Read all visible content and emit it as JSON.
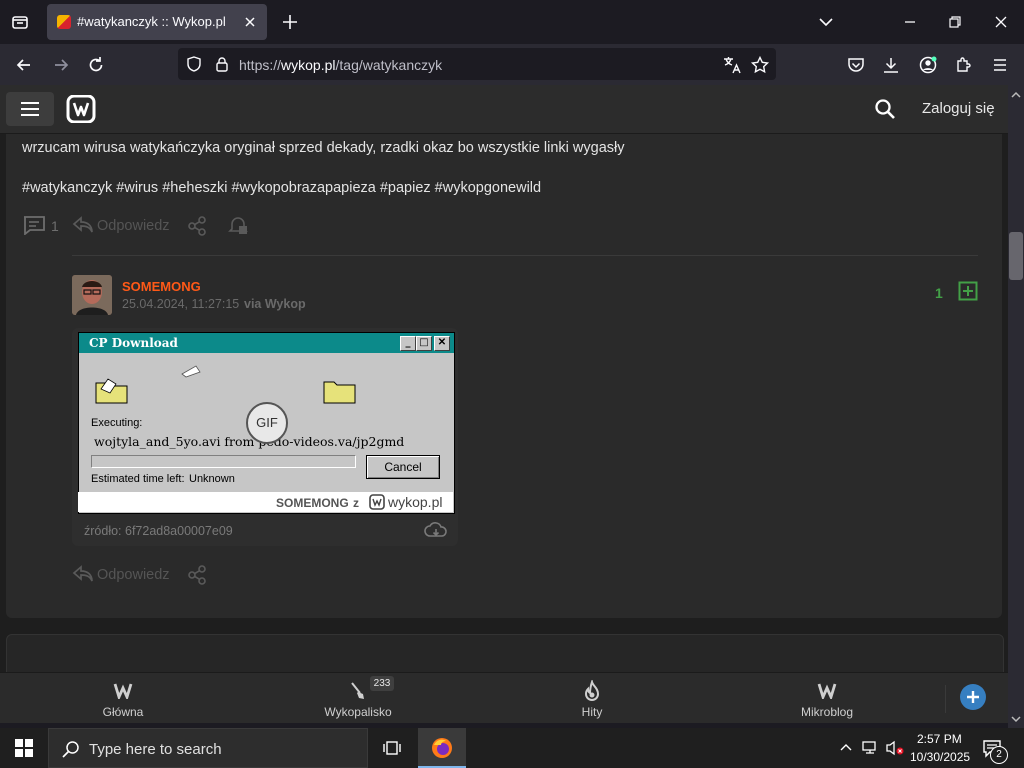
{
  "browser": {
    "tab_title": "#watykanczyk :: Wykop.pl",
    "url_scheme": "https://",
    "url_host": "wykop.pl",
    "url_path": "/tag/watykanczyk",
    "colors": {
      "chrome_bg": "#1c1b22",
      "toolbar_bg": "#2b2a33"
    }
  },
  "site": {
    "login_label": "Zaloguj się",
    "accent": "#ff5917"
  },
  "post": {
    "text": "wrzucam wirusa watykańczyka oryginał sprzed dekady, rzadki okaz bo wszystkie linki wygasły",
    "tags": "#watykanczyk #wirus #heheszki #wykopobrazapapieza #papiez #wykopgonewild",
    "comment_count": "1",
    "reply_label": "Odpowiedz"
  },
  "comment": {
    "author": "SOMEMONG",
    "date": "25.04.2024, 11:27:15",
    "via": "via Wykop",
    "votes": "1",
    "source_label": "źródło: 6f72ad8a00007e09",
    "reply_label": "Odpowiedz",
    "gif_badge": "GIF",
    "dialog": {
      "title": "CP Download",
      "executing_label": "Executing:",
      "file_line": "wojtyla_and_5yo.avi from pedo-videos.va/jp2gmd",
      "cancel_label": "Cancel",
      "time_left_label": "Estimated time left:",
      "time_left_value": "Unknown",
      "watermark_user": "SOMEMONG",
      "watermark_z": "z",
      "watermark_site": "wykop.pl"
    }
  },
  "bottom_nav": {
    "items": [
      {
        "label": "Główna"
      },
      {
        "label": "Wykopalisko",
        "badge": "233"
      },
      {
        "label": "Hity"
      },
      {
        "label": "Mikroblog"
      }
    ]
  },
  "taskbar": {
    "search_placeholder": "Type here to search",
    "time": "2:57 PM",
    "date": "10/30/2025",
    "notifications": "2"
  }
}
